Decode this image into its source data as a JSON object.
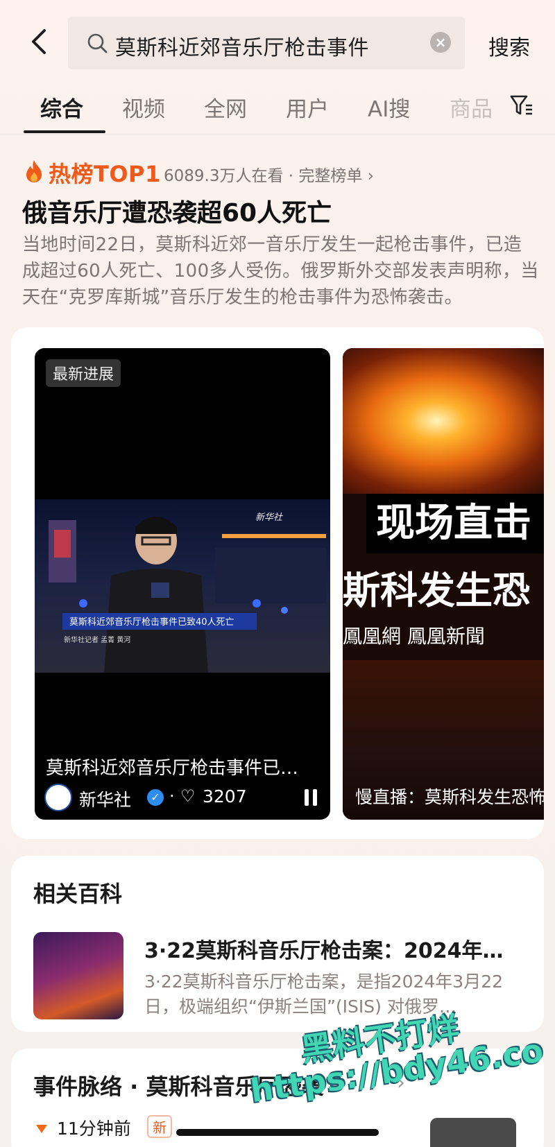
{
  "search": {
    "query": "莫斯科近郊音乐厅枪击事件",
    "submit_label": "搜索"
  },
  "tabs": [
    {
      "label": "综合",
      "active": true
    },
    {
      "label": "视频"
    },
    {
      "label": "全网"
    },
    {
      "label": "用户"
    },
    {
      "label": "AI搜"
    },
    {
      "label": "商品"
    }
  ],
  "hot": {
    "rank_label": "热榜TOP1",
    "viewers": "6089.3万人在看",
    "full_list_link": "· 完整榜单",
    "headline": "俄音乐厅遭恐袭超60人死亡",
    "summary": "当地时间22日，莫斯科近郊一音乐厅发生一起枪击事件，已造成超过60人死亡、100多人受伤。俄罗斯外交部发表声明称，当天在“克罗库斯城”音乐厅发生的枪击事件为恐怖袭击。"
  },
  "videos": [
    {
      "badge": "最新进展",
      "title": "莫斯科近郊音乐厅枪击事件已…",
      "author": "新华社",
      "likes": "3207",
      "overlay_caption": "莫斯科近郊音乐厅枪击事件已致40人死亡",
      "overlay_credit": "新华社记者 孟菁 黄河",
      "watermark": "新华社"
    },
    {
      "banner": "现场直击",
      "banner2": "斯科发生恐",
      "brand": "鳳凰網 鳳凰新聞",
      "title": "慢直播：莫斯科发生恐怖"
    }
  ],
  "baike": {
    "section_title": "相关百科",
    "entry_title": "3·22莫斯科音乐厅枪击案：2024年…",
    "entry_desc": "3·22莫斯科音乐厅枪击案，是指2024年3月22日，极端组织“伊斯兰国”(ISIS) 对俄罗…"
  },
  "timeline": {
    "section_title": "事件脉络 · 莫斯科音乐厅恐袭",
    "time": "11分钟前",
    "new_tag": "新"
  },
  "watermark": {
    "line1": "黑料不打烊",
    "line2": "https://bdy46.co"
  },
  "colors": {
    "accent": "#f05a1a",
    "verify": "#2d8cf0",
    "watermark": "#43d6b4"
  }
}
